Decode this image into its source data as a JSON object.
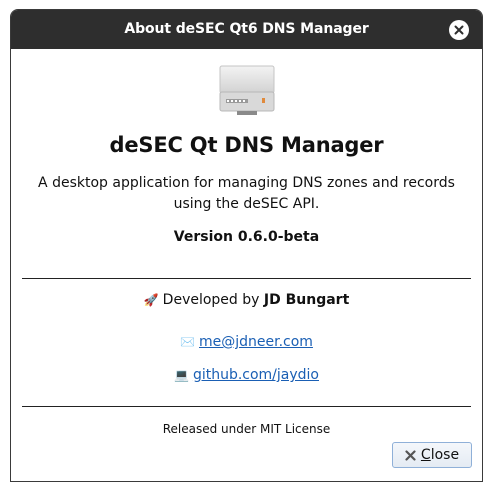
{
  "window": {
    "title": "About deSEC Qt6 DNS Manager",
    "close_icon": "close-icon"
  },
  "about": {
    "logo_icon": "computer-icon",
    "app_name": "deSEC Qt DNS Manager",
    "description": "A desktop application for managing DNS zones and records using the deSEC API.",
    "version": "Version 0.6.0-beta",
    "developed_by_prefix": "Developed by",
    "developer": "JD Bungart",
    "developer_emoji": "🚀",
    "email_emoji": "✉️",
    "email": "me@jdneer.com",
    "github_emoji": "💻",
    "github": "github.com/jaydio",
    "license": "Released under MIT License"
  },
  "buttons": {
    "close_first": "C",
    "close_rest": "lose",
    "close_icon": "close-icon"
  }
}
